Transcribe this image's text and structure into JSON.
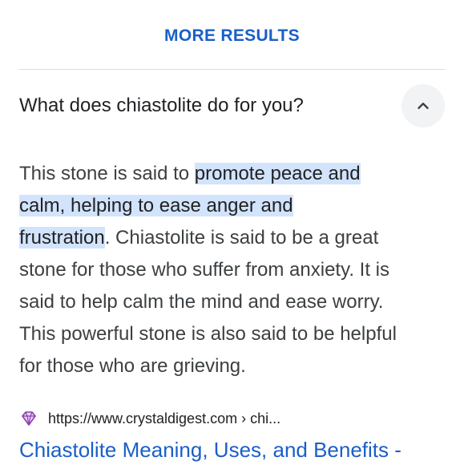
{
  "more_results": {
    "label": "MORE RESULTS"
  },
  "question": {
    "text": "What does chiastolite do for you?",
    "toggle_icon": "chevron-up-icon"
  },
  "answer": {
    "line1_plain": "This stone is said to ",
    "line1_highlight": "promote peace and",
    "line2_highlight": "calm, helping to ease anger and",
    "line3_highlight": "frustration",
    "line3_plain": ". Chiastolite is said to be a great",
    "line4": "stone for those who suffer from anxiety. It is",
    "line5": "said to help calm the mind and ease worry.",
    "line6": "This powerful stone is also said to be helpful",
    "line7": "for those who are grieving."
  },
  "source": {
    "icon": "diamond-icon",
    "url": "https://www.crystaldigest.com › chi..."
  },
  "result": {
    "title": "Chiastolite Meaning, Uses, and Benefits -"
  },
  "colors": {
    "link": "#1a5fc7",
    "highlight": "#d2e3fc",
    "text": "#3c4043",
    "divider": "#dadce0",
    "favicon": "#8a3fb0"
  }
}
